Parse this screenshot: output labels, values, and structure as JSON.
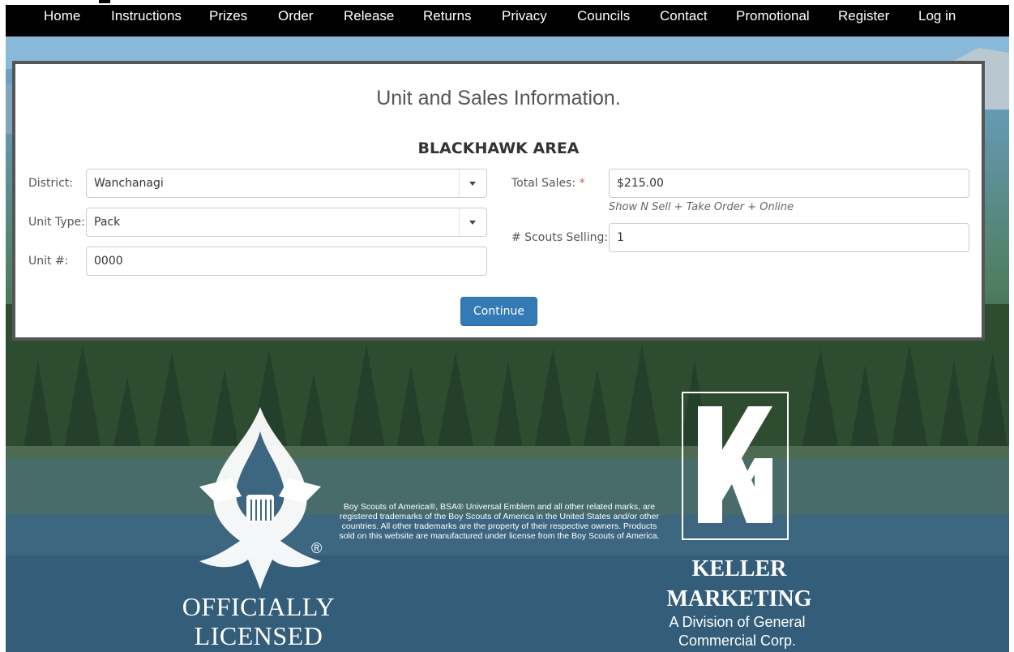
{
  "nav": {
    "items": [
      {
        "label": "Home"
      },
      {
        "label": "Instructions"
      },
      {
        "label": "Prizes"
      },
      {
        "label": "Order"
      },
      {
        "label": "Release"
      },
      {
        "label": "Returns"
      },
      {
        "label": "Privacy"
      },
      {
        "label": "Councils"
      },
      {
        "label": "Contact"
      },
      {
        "label": "Promotional"
      },
      {
        "label": "Register"
      },
      {
        "label": "Log in"
      }
    ]
  },
  "form": {
    "title": "Unit and Sales Information.",
    "council": "BLACKHAWK AREA",
    "district_label": "District:",
    "district_value": "Wanchanagi",
    "unit_type_label": "Unit Type:",
    "unit_type_value": "Pack",
    "unit_number_label": "Unit #:",
    "unit_number_value": "0000",
    "total_sales_label": "Total Sales:",
    "total_sales_value": "$215.00",
    "total_sales_help": "Show N Sell + Take Order + Online",
    "scouts_selling_label": "# Scouts Selling:",
    "scouts_selling_value": "1",
    "required_marker": "*",
    "continue_label": "Continue"
  },
  "footer": {
    "legal_text": "Boy Scouts of America®, BSA® Universal Emblem and all other related marks, are registered trademarks of the Boy Scouts of America in the United States and/or other countries. All other trademarks are the property of their respective owners. Products sold on this website are manufactured under license from the Boy Scouts of America.",
    "officially_licensed_line1": "OFFICIALLY",
    "officially_licensed_line2": "LICENSED",
    "registered_mark": "®",
    "keller_line1": "KELLER",
    "keller_line2": "MARKETING",
    "division_line1": "A Division of General",
    "division_line2": "Commercial Corp."
  },
  "colors": {
    "primary_button": "#337ab7",
    "required": "#d9534f",
    "nav_background": "#000000"
  },
  "icons": {
    "select_caret": "chevron-down-icon",
    "bsa_emblem": "fleur-de-lis-eagle-logo",
    "keller_logo": "km-logo"
  }
}
